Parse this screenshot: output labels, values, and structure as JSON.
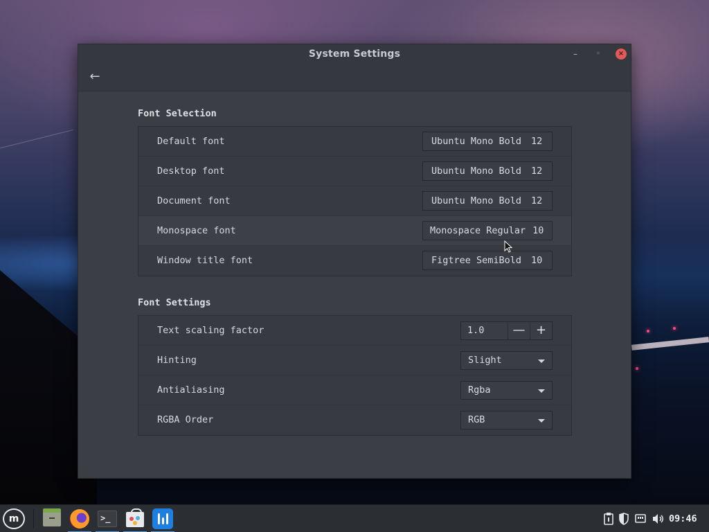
{
  "window": {
    "title": "System Settings",
    "minimize_glyph": "–",
    "maximize_glyph": "◦",
    "close_glyph": "×",
    "back_glyph": "←"
  },
  "font_selection": {
    "title": "Font Selection",
    "rows": [
      {
        "label": "Default font",
        "font": "Ubuntu Mono Bold",
        "size": "12"
      },
      {
        "label": "Desktop font",
        "font": "Ubuntu Mono Bold",
        "size": "12"
      },
      {
        "label": "Document font",
        "font": "Ubuntu Mono Bold",
        "size": "12"
      },
      {
        "label": "Monospace font",
        "font": "Monospace Regular",
        "size": "10"
      },
      {
        "label": "Window title font",
        "font": "Figtree SemiBold",
        "size": "10"
      }
    ]
  },
  "font_settings": {
    "title": "Font Settings",
    "text_scaling": {
      "label": "Text scaling factor",
      "value": "1.0",
      "minus": "—",
      "plus": "+"
    },
    "hinting": {
      "label": "Hinting",
      "value": "Slight"
    },
    "antialiasing": {
      "label": "Antialiasing",
      "value": "Rgba"
    },
    "rgba_order": {
      "label": "RGBA Order",
      "value": "RGB"
    }
  },
  "taskbar": {
    "menu_glyph": "m",
    "terminal_glyph": ">_",
    "clock": "09:46",
    "tray_icons": [
      "clipboard-icon",
      "shield-icon",
      "network-icon",
      "volume-icon"
    ]
  }
}
